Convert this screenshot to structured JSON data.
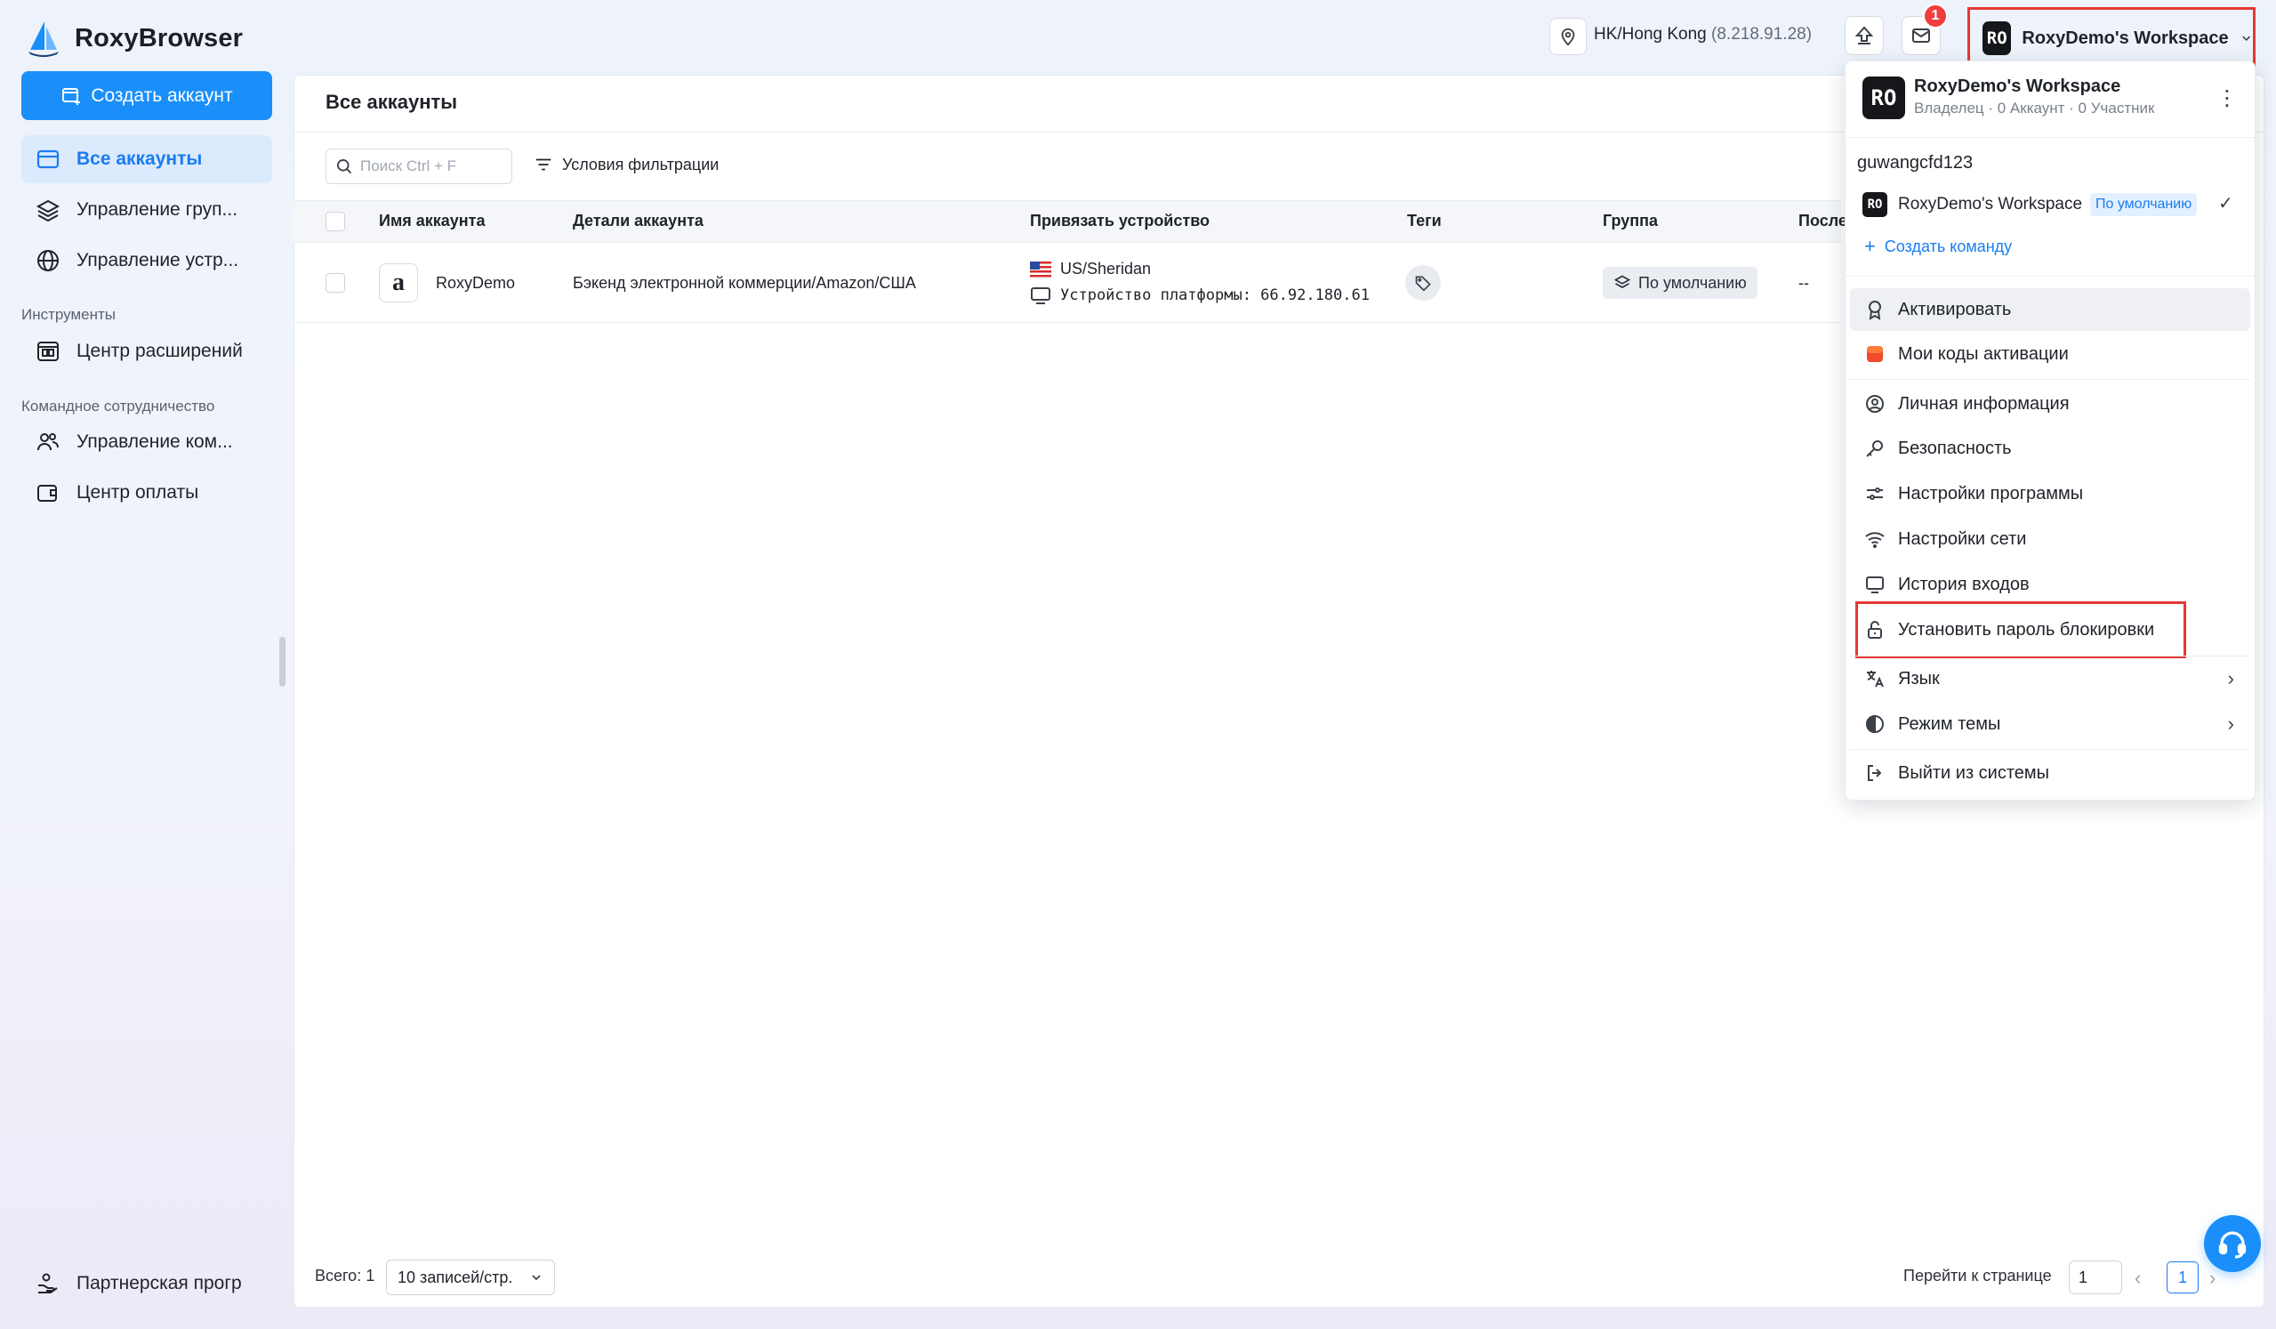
{
  "app": {
    "name": "RoxyBrowser"
  },
  "sidebar": {
    "create_label": "Создать аккаунт",
    "items": [
      {
        "label": "Все аккаунты"
      },
      {
        "label": "Управление груп..."
      },
      {
        "label": "Управление устр..."
      }
    ],
    "tools_section": "Инструменты",
    "tools": [
      {
        "label": "Центр расширений"
      }
    ],
    "team_section": "Командное сотрудничество",
    "team": [
      {
        "label": "Управление ком..."
      },
      {
        "label": "Центр оплаты"
      }
    ],
    "partner_label": "Партнерская прогр"
  },
  "topbar": {
    "location": "HK/Hong Kong",
    "ip": "(8.218.91.28)",
    "notification_count": "1",
    "workspace_initials": "RO",
    "workspace_name": "RoxyDemo's Workspace"
  },
  "main": {
    "title": "Все аккаунты",
    "search_placeholder": "Поиск Ctrl + F",
    "filter_label": "Условия фильтрации",
    "columns": [
      "Имя аккаунта",
      "Детали аккаунта",
      "Привязать устройство",
      "Теги",
      "Группа",
      "После"
    ],
    "rows": [
      {
        "name": "RoxyDemo",
        "details": "Бэкенд электронной коммерции/Amazon/США",
        "device_location": "US/Sheridan",
        "device_platform": "Устройство платформы: 66.92.180.61",
        "group": "По умолчанию",
        "last": "--"
      }
    ],
    "total_label": "Всего: 1",
    "page_size": "10 записей/стр.",
    "goto_label": "Перейти к странице",
    "goto_value": "1",
    "current_page": "1"
  },
  "menu": {
    "workspace_initials": "RO",
    "workspace_name": "RoxyDemo's Workspace",
    "workspace_meta": "Владелец · 0 Аккаунт · 0 Участник",
    "username": "guwangcfd123",
    "team_initials": "RO",
    "team_name": "RoxyDemo's Workspace",
    "default_badge": "По умолчанию",
    "create_team": "Создать команду",
    "items": [
      {
        "label": "Активировать"
      },
      {
        "label": "Мои коды активации"
      },
      {
        "label": "Личная информация"
      },
      {
        "label": "Безопасность"
      },
      {
        "label": "Настройки программы"
      },
      {
        "label": "Настройки сети"
      },
      {
        "label": "История входов"
      },
      {
        "label": "Установить пароль блокировки"
      },
      {
        "label": "Язык"
      },
      {
        "label": "Режим темы"
      },
      {
        "label": "Выйти из системы"
      }
    ]
  },
  "colors": {
    "accent": "#1a8ffa",
    "highlight": "#e53935",
    "active_bg": "#dbeafc"
  }
}
